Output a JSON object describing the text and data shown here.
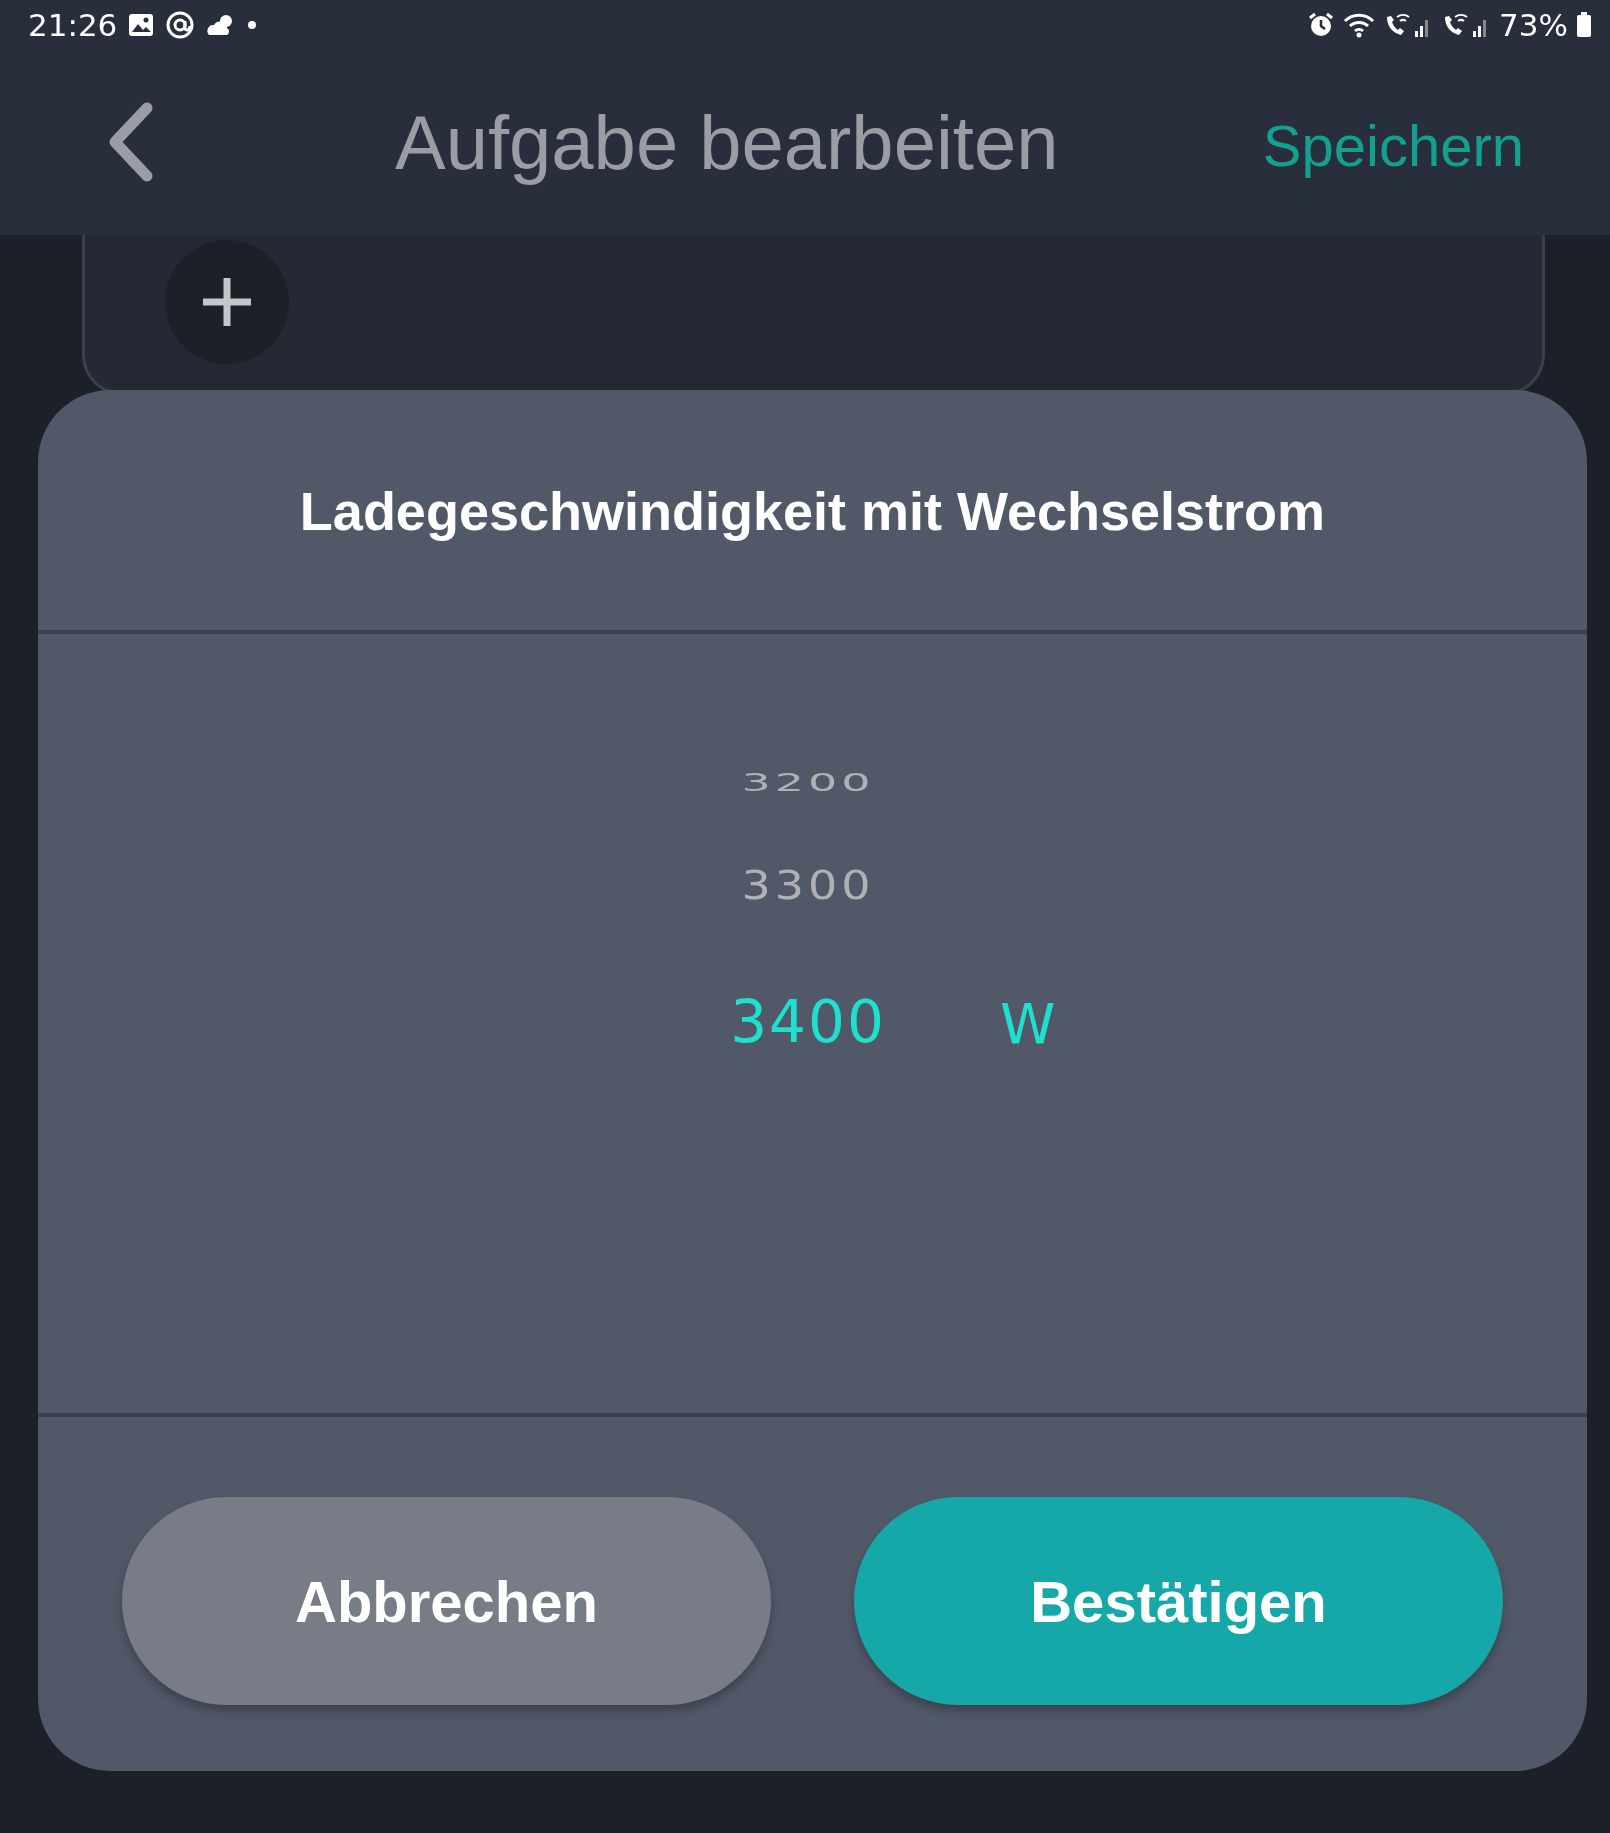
{
  "status_bar": {
    "time": "21:26",
    "battery": "73%"
  },
  "header": {
    "title": "Aufgabe bearbeiten",
    "action": "Speichern"
  },
  "dialog": {
    "title": "Ladegeschwindigkeit mit Wechselstrom",
    "picker": {
      "items": [
        {
          "value": "3200",
          "selected": false
        },
        {
          "value": "3300",
          "selected": false
        },
        {
          "value": "3400",
          "selected": true
        }
      ],
      "unit": "W"
    },
    "buttons": [
      {
        "label": "Abbrechen",
        "kind": "secondary"
      },
      {
        "label": "Bestätigen",
        "kind": "primary"
      }
    ]
  }
}
